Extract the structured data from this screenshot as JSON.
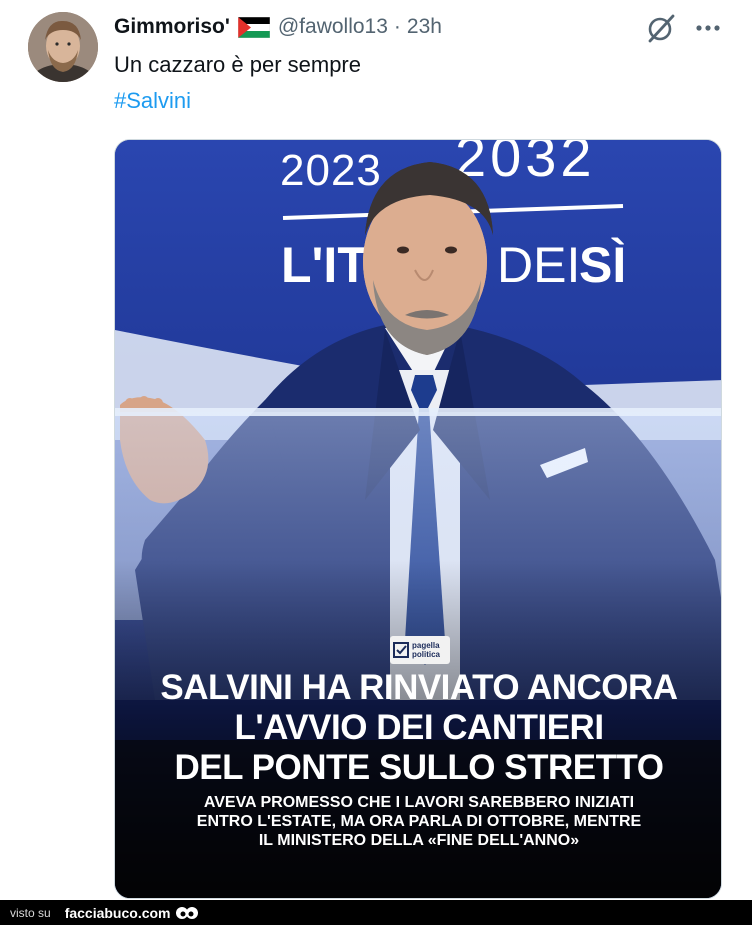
{
  "tweet": {
    "display_name": "Gimmoriso'",
    "handle": "@fawollo13",
    "separator": "·",
    "time": "23h",
    "text": "Un cazzaro è per sempre",
    "hashtag": "#Salvini",
    "flag_icon": "palestine-flag-icon",
    "menu_icons": [
      "grok-icon",
      "more-icon"
    ]
  },
  "media": {
    "background_text": {
      "year_left": "2023",
      "year_right": "2032",
      "slogan_left": "L'IT",
      "slogan_mid": "DEI",
      "slogan_right": "SÌ"
    },
    "publisher": {
      "line1": "pagella",
      "line2": "politica"
    },
    "headline_lines": [
      "SALVINI HA RINVIATO ANCORA",
      "L'AVVIO DEI CANTIERI",
      "DEL PONTE SULLO STRETTO"
    ],
    "subhead_lines": [
      "AVEVA PROMESSO CHE I LAVORI SAREBBERO INIZIATI",
      "ENTRO L'ESTATE, MA ORA PARLA DI OTTOBRE, MENTRE",
      "IL MINISTERO DELLA «FINE DELL'ANNO»"
    ]
  },
  "watermark": {
    "prefix": "visto su",
    "site": "facciabuco.com"
  },
  "colors": {
    "hashtag": "#1d9bf0",
    "muted": "#536471",
    "stage_blue": "#1c2f8a"
  }
}
